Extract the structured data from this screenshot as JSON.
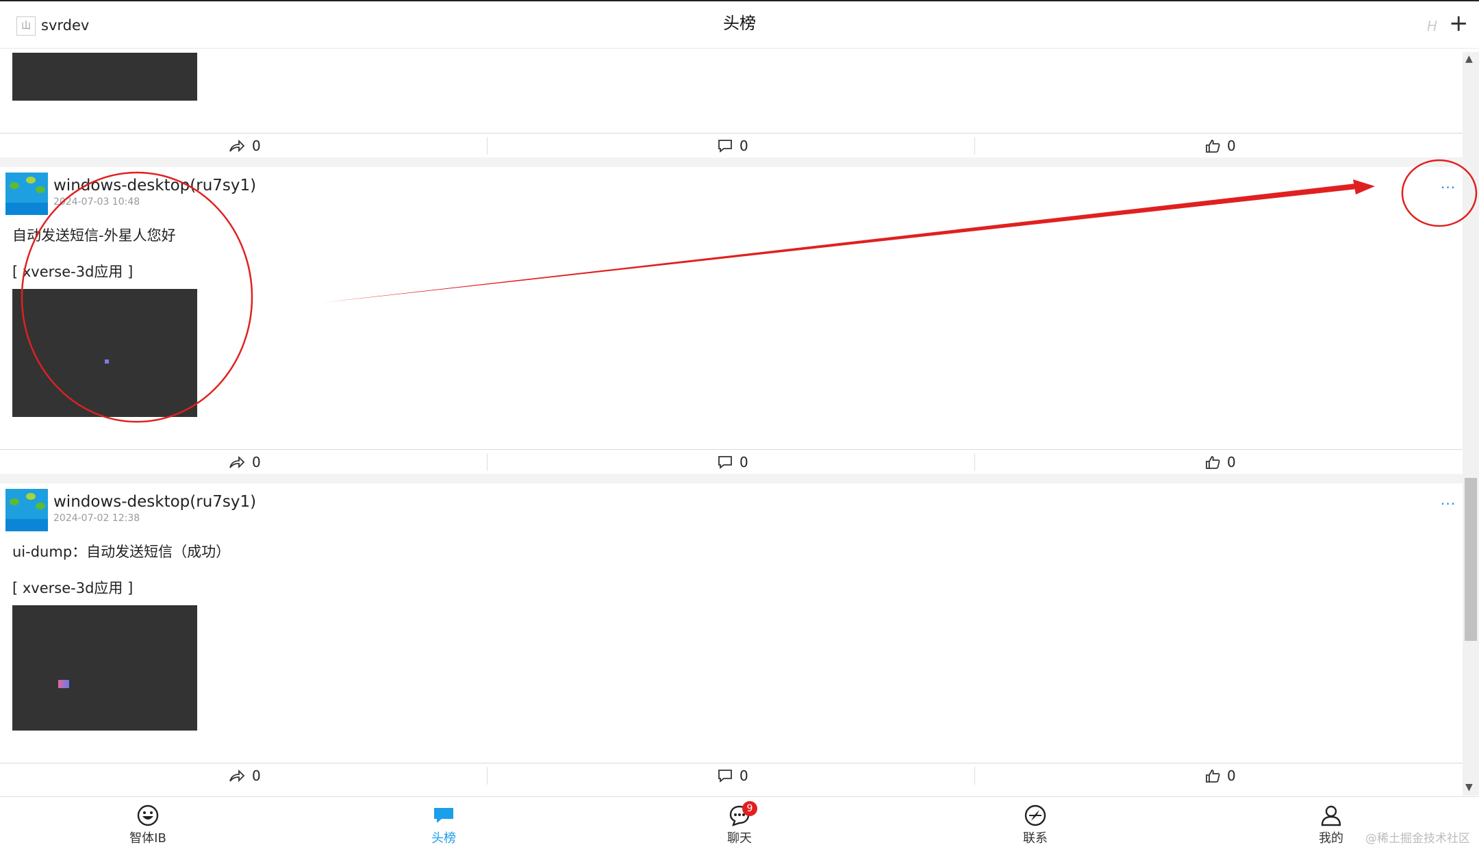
{
  "header": {
    "app_logo": "山",
    "app_name": "svrdev",
    "title": "头榜",
    "h_indicator": "H",
    "add_icon": "plus-icon"
  },
  "posts": [
    {
      "partial": true,
      "actions": {
        "share_count": "0",
        "comment_count": "0",
        "like_count": "0"
      }
    },
    {
      "user": "windows-desktop(ru7sy1)",
      "time": "2024-07-03 10:48",
      "text": "自动发送短信-外星人您好",
      "app_tag": "[ xverse-3d应用 ]",
      "more": "···",
      "actions": {
        "share_count": "0",
        "comment_count": "0",
        "like_count": "0"
      }
    },
    {
      "user": "windows-desktop(ru7sy1)",
      "time": "2024-07-02 12:38",
      "text": "ui-dump：自动发送短信（成功）",
      "app_tag": "[ xverse-3d应用 ]",
      "more": "···",
      "actions": {
        "share_count": "0",
        "comment_count": "0",
        "like_count": "0"
      }
    }
  ],
  "tabbar": {
    "items": [
      {
        "label": "智体IB",
        "icon": "smiley-icon"
      },
      {
        "label": "头榜",
        "icon": "chat-bubble-icon",
        "active": true
      },
      {
        "label": "聊天",
        "icon": "message-icon",
        "badge": "9"
      },
      {
        "label": "联系",
        "icon": "compass-icon"
      },
      {
        "label": "我的",
        "icon": "user-icon"
      }
    ]
  },
  "colors": {
    "accent": "#1a9fe8",
    "badge": "#e02020",
    "annotation": "#e02020",
    "image_placeholder": "#333333"
  },
  "watermark": "@稀土掘金技术社区"
}
